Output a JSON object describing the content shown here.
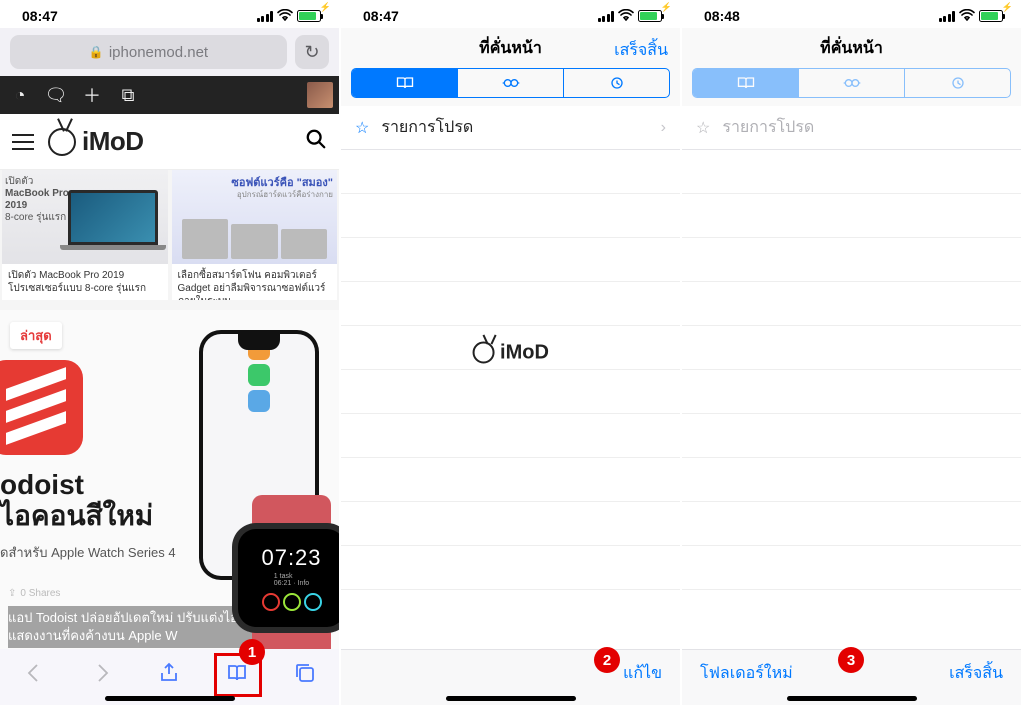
{
  "s1": {
    "time": "08:47",
    "url": "iphonemod.net",
    "site_brand": "iMoD",
    "latest_badge": "ล่าสุด",
    "card1_label_l1": "เปิดตัว",
    "card1_label_l2": "MacBook Pro",
    "card1_label_l3": "2019",
    "card1_label_l4": "8-core รุ่นแรก",
    "card1_caption": "เปิดตัว MacBook Pro 2019 โปรเซสเซอร์แบบ 8-core รุ่นแรก",
    "card2_headline": "ซอฟต์แวร์คือ \"สมอง\"",
    "card2_sub": "อุปกรณ์ฮาร์ดแวร์คือร่างกาย",
    "card2_caption": "เลือกซื้อสมาร์ตโฟน คอมพิวเตอร์ Gadget อย่าลืมพิจารณาซอฟต์แวร์ภายในระบบ",
    "feat_title_l1": "odoist",
    "feat_title_l2": "ไอคอนสีใหม่",
    "feat_sub": "ดสำหรับ Apple Watch Series 4",
    "feat_shares": "0 Shares",
    "feat_excerpt": "แอป Todoist ปล่อยอัปเดตใหม่ ปรับแต่งไอคอนได้และแสดงงานที่คงค้างบน Apple W",
    "watch_time": "07:23",
    "watch_task": "1 task",
    "watch_info": "06:21 · Info",
    "badge": "1"
  },
  "s2": {
    "time": "08:47",
    "title": "ที่คั่นหน้า",
    "done": "เสร็จสิ้น",
    "row_fav": "รายการโปรด",
    "edit": "แก้ไข",
    "badge": "2"
  },
  "s3": {
    "time": "08:48",
    "title": "ที่คั่นหน้า",
    "row_fav": "รายการโปรด",
    "new_folder": "โฟลเดอร์ใหม่",
    "done": "เสร็จสิ้น",
    "badge": "3"
  },
  "wm_brand": "iMoD"
}
